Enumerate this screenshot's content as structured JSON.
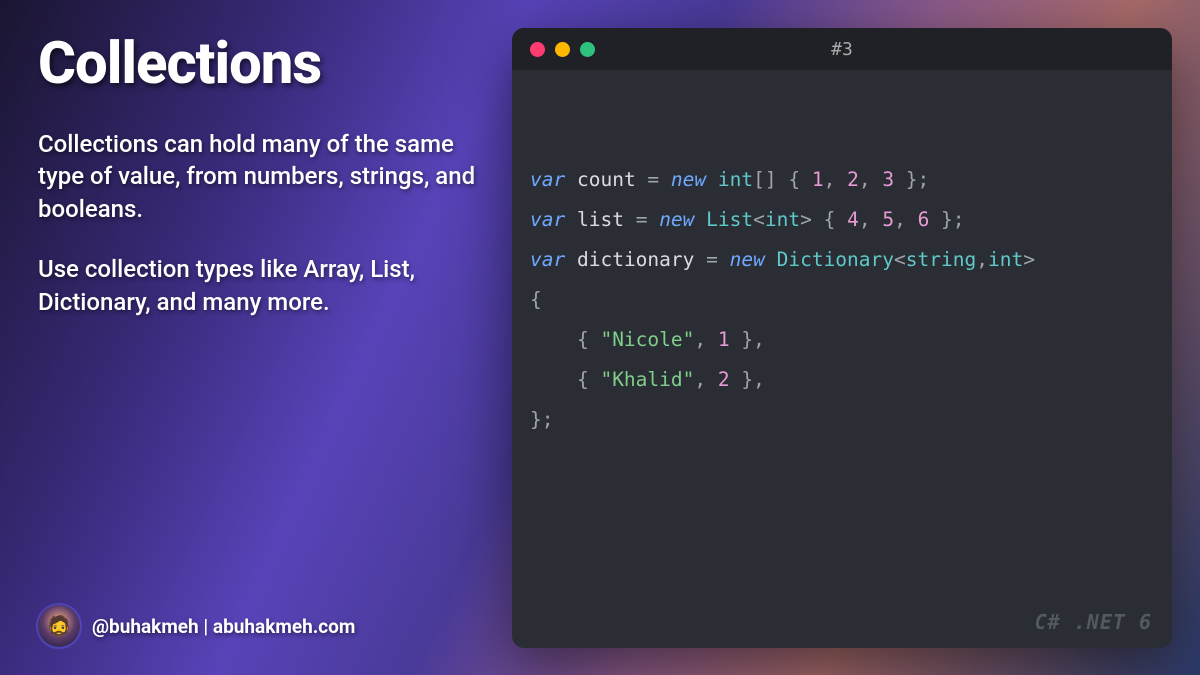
{
  "title": "Collections",
  "para1": "Collections can hold many of the same type of value, from numbers, strings, and booleans.",
  "para2": "Use collection types like Array, List, Dictionary, and many more.",
  "footer": {
    "handle": "@buhakmeh",
    "sep": "  |  ",
    "site": "abuhakmeh.com"
  },
  "window": {
    "title": "#3",
    "lang": "C# .NET 6"
  },
  "code": {
    "l1": {
      "kw_var": "var",
      "id": "count",
      "eq": " = ",
      "kw_new": "new",
      "ty": "int",
      "brk": "[] { ",
      "n1": "1",
      "c1": ", ",
      "n2": "2",
      "c2": ", ",
      "n3": "3",
      "end": " };"
    },
    "l2": {
      "kw_var": "var",
      "id": "list",
      "eq": " = ",
      "kw_new": "new",
      "ty": "List",
      "lt": "<",
      "ty2": "int",
      "gt": "> { ",
      "n1": "4",
      "c1": ", ",
      "n2": "5",
      "c2": ", ",
      "n3": "6",
      "end": " };"
    },
    "l3": {
      "kw_var": "var",
      "id": "dictionary",
      "eq": " = ",
      "kw_new": "new",
      "ty": "Dictionary",
      "lt": "<",
      "ty2": "string",
      "cm": ",",
      "ty3": "int",
      "gt": ">"
    },
    "l4": {
      "open": "{"
    },
    "l5": {
      "indent": "    ",
      "open": "{ ",
      "str": "\"Nicole\"",
      "cm": ", ",
      "num": "1",
      "close": " },"
    },
    "l6": {
      "indent": "    ",
      "open": "{ ",
      "str": "\"Khalid\"",
      "cm": ", ",
      "num": "2",
      "close": " },"
    },
    "l7": {
      "close": "};"
    }
  }
}
